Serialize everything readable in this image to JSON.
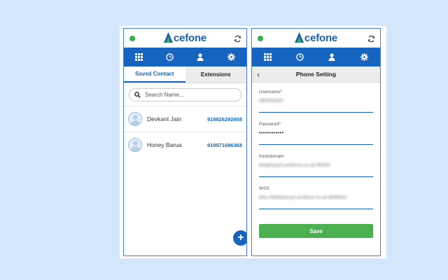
{
  "brand": {
    "name_rest": "cefone",
    "logo_colors": {
      "blue": "#1a5fb4",
      "green": "#2fb24c"
    }
  },
  "colors": {
    "nav": "#1565c0",
    "status_dot": "#2fb24c",
    "save": "#4caf50"
  },
  "nav": {
    "items": [
      {
        "icon": "dialpad-icon"
      },
      {
        "icon": "clock-icon"
      },
      {
        "icon": "user-icon"
      },
      {
        "icon": "gear-icon"
      }
    ]
  },
  "contacts_screen": {
    "tabs": {
      "saved": "Saved Contact",
      "extensions": "Extensions"
    },
    "search": {
      "placeholder": "Search Name..."
    },
    "contacts": [
      {
        "name": "Devkant Jain",
        "number": "919826292608"
      },
      {
        "name": "Honey Barua",
        "number": "919971696368"
      }
    ],
    "fab": "+"
  },
  "settings_screen": {
    "back": "‹",
    "title": "Phone Setting",
    "fields": {
      "username": {
        "label": "Username*",
        "value": "090500062"
      },
      "password": {
        "label": "Password*",
        "value": "••••••••••••"
      },
      "host": {
        "label": "host/domain",
        "value": "telephony3.acefone.co.uk:05553"
      },
      "wss": {
        "label": "WSS",
        "value": "wss://telephony3.acefone.co.uk:8089/ws"
      }
    },
    "save_label": "Save"
  }
}
